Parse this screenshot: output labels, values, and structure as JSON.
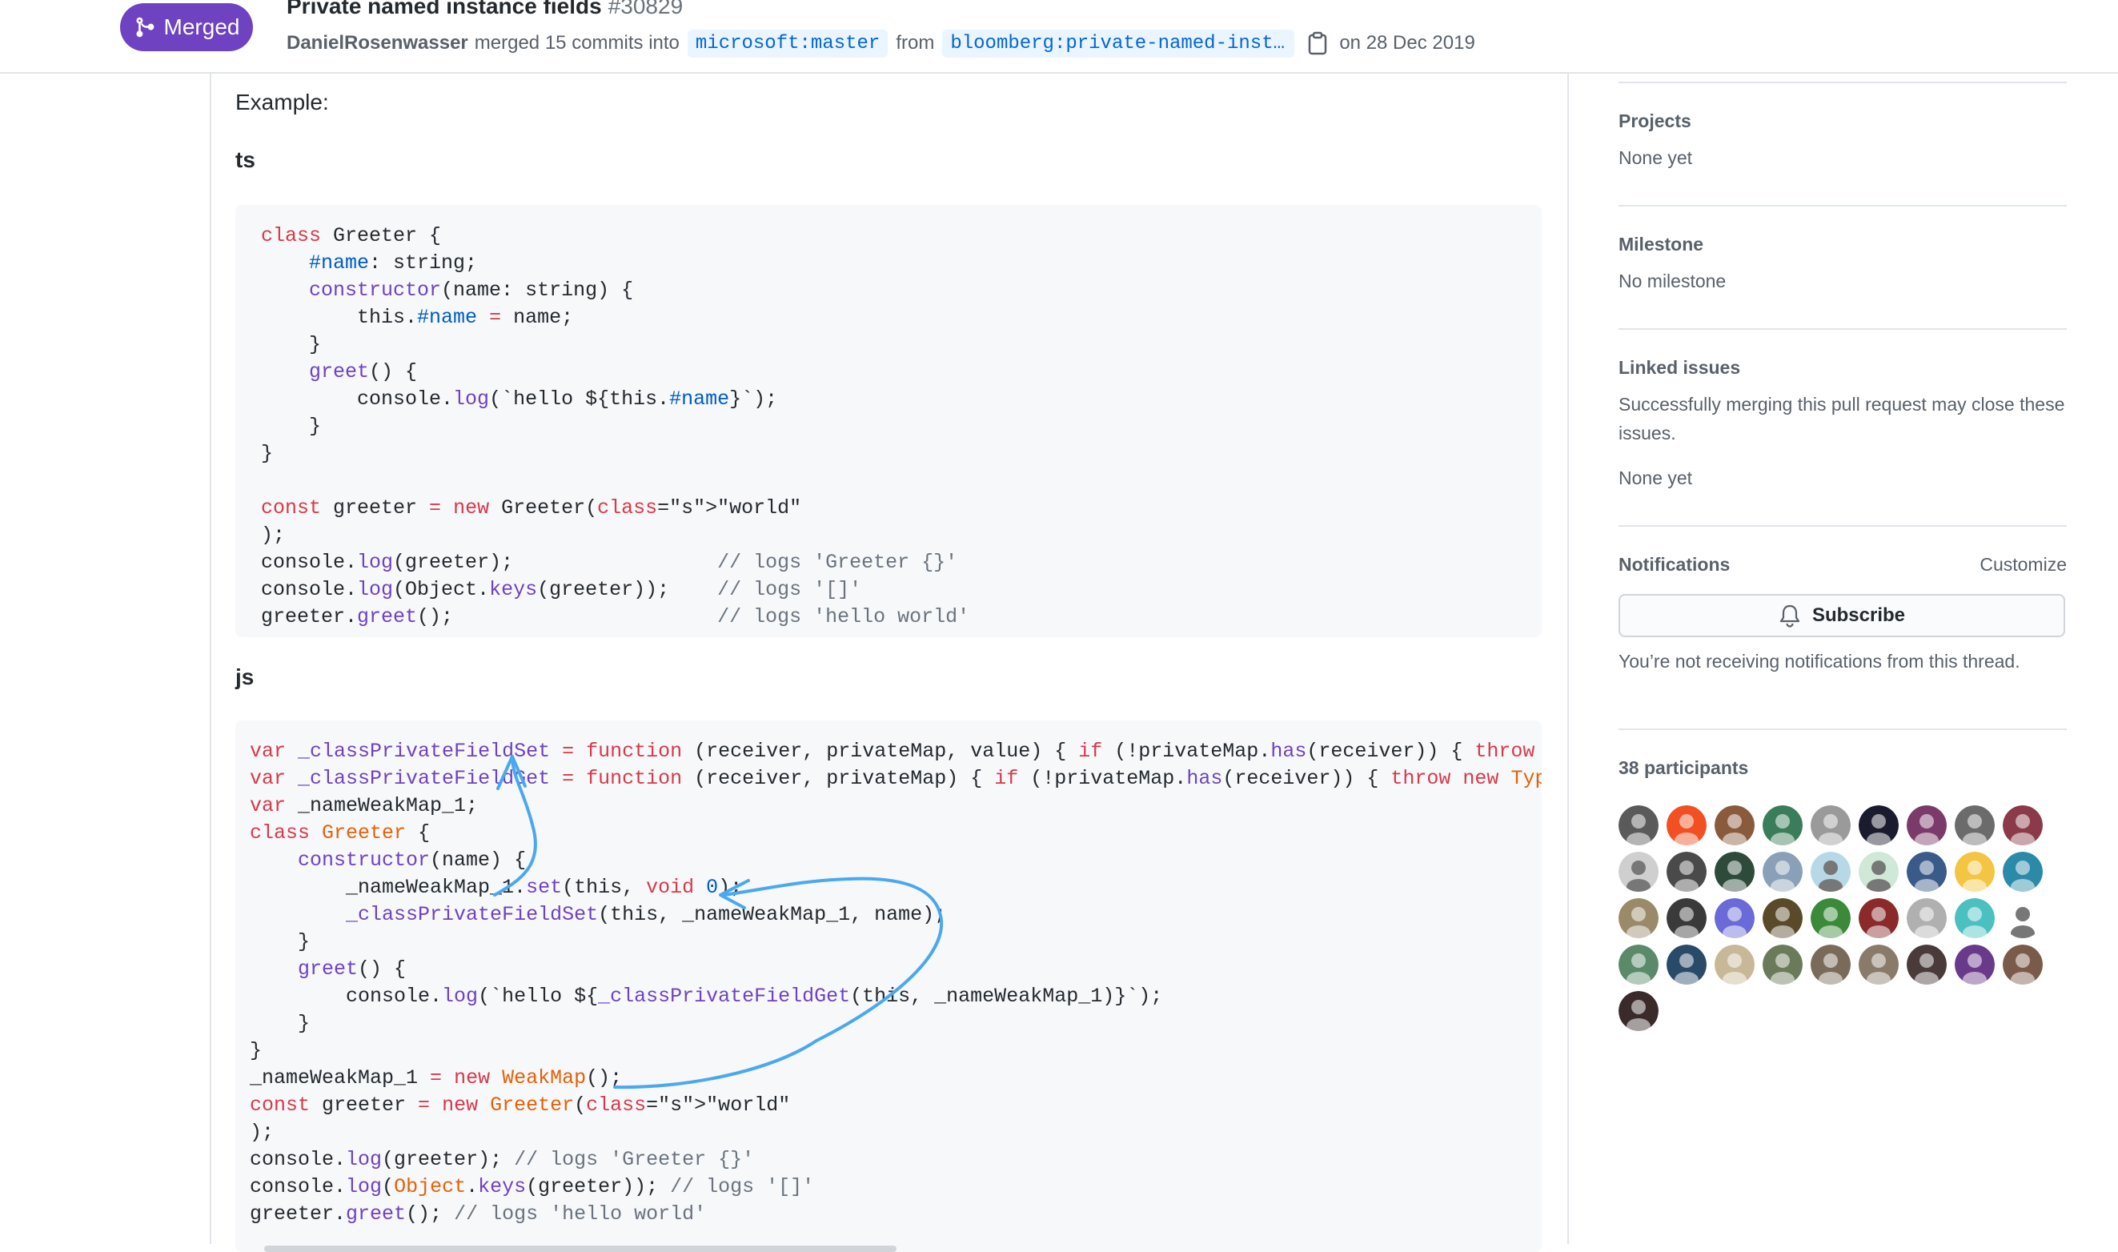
{
  "header": {
    "badge": "Merged",
    "title": "Private named instance fields",
    "number": "#30829",
    "author": "DanielRosenwasser",
    "merged_text": "merged 15 commits into",
    "base_branch": "microsoft:master",
    "from_text": "from",
    "head_branch": "bloomberg:private-named-insta…",
    "date_text": "on 28 Dec 2019"
  },
  "body": {
    "example_label": "Example:",
    "ts_heading": "ts",
    "js_heading": "js"
  },
  "code_ts": [
    "class Greeter {",
    "    #name: string;",
    "    constructor(name: string) {",
    "        this.#name = name;",
    "    }",
    "    greet() {",
    "        console.log(`hello ${this.#name}`);",
    "    }",
    "}",
    "",
    "const greeter = new Greeter(\"world\");",
    "console.log(greeter);                 // logs 'Greeter {}'",
    "console.log(Object.keys(greeter));    // logs '[]'",
    "greeter.greet();                      // logs 'hello world'"
  ],
  "code_js": [
    "var _classPrivateFieldSet = function (receiver, privateMap, value) { if (!privateMap.has(receiver)) { throw new",
    "var _classPrivateFieldGet = function (receiver, privateMap) { if (!privateMap.has(receiver)) { throw new TypeErr",
    "var _nameWeakMap_1;",
    "class Greeter {",
    "    constructor(name) {",
    "        _nameWeakMap_1.set(this, void 0);",
    "        _classPrivateFieldSet(this, _nameWeakMap_1, name);",
    "    }",
    "    greet() {",
    "        console.log(`hello ${_classPrivateFieldGet(this, _nameWeakMap_1)}`);",
    "    }",
    "}",
    "_nameWeakMap_1 = new WeakMap();",
    "const greeter = new Greeter(\"world\");",
    "console.log(greeter); // logs 'Greeter {}'",
    "console.log(Object.keys(greeter)); // logs '[]'",
    "greeter.greet(); // logs 'hello world'"
  ],
  "sidebar": {
    "projects": {
      "title": "Projects",
      "value": "None yet"
    },
    "milestone": {
      "title": "Milestone",
      "value": "No milestone"
    },
    "linked": {
      "title": "Linked issues",
      "desc": "Successfully merging this pull request may close these issues.",
      "value": "None yet"
    },
    "notifications": {
      "title": "Notifications",
      "customize": "Customize",
      "subscribe": "Subscribe",
      "desc": "You’re not receiving notifications from this thread."
    },
    "participants": {
      "title": "38 participants"
    }
  },
  "colors": {
    "merged": "#6f42c1",
    "link": "#0366d6",
    "annotation": "#4aa8ef"
  }
}
